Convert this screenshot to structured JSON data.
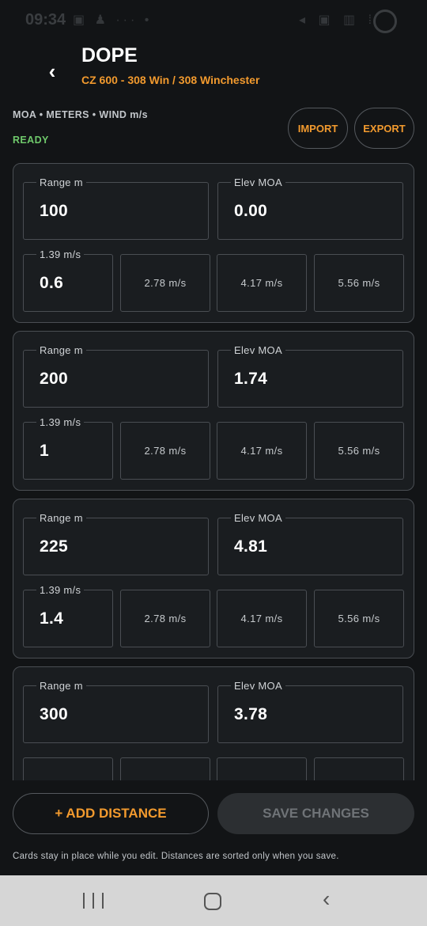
{
  "status_bar": {
    "time": "09:34",
    "left_icons": "▣ ♟ ··· •",
    "right_icons": "◂ ▣ ▥ ⁞"
  },
  "header": {
    "back_glyph": "‹",
    "title": "DOPE",
    "subtitle": "CZ 600 - 308 Win / 308 Winchester",
    "units": "MOA • METERS • WIND m/s",
    "status": "READY",
    "import_label": "IMPORT",
    "export_label": "EXPORT"
  },
  "colors": {
    "accent": "#f29a2e",
    "ready": "#6fc96b",
    "background": "#121416",
    "card": "#1a1d20",
    "border": "#4a4e53"
  },
  "cards": [
    {
      "range_label": "Range m",
      "range": "100",
      "elev_label": "Elev MOA",
      "elev": "0.00",
      "wind": [
        {
          "label": "1.39 m/s",
          "value": "0.6"
        },
        {
          "placeholder": "2.78 m/s"
        },
        {
          "placeholder": "4.17 m/s"
        },
        {
          "placeholder": "5.56 m/s"
        }
      ]
    },
    {
      "range_label": "Range m",
      "range": "200",
      "elev_label": "Elev MOA",
      "elev": "1.74",
      "wind": [
        {
          "label": "1.39 m/s",
          "value": "1"
        },
        {
          "placeholder": "2.78 m/s"
        },
        {
          "placeholder": "4.17 m/s"
        },
        {
          "placeholder": "5.56 m/s"
        }
      ]
    },
    {
      "range_label": "Range m",
      "range": "225",
      "elev_label": "Elev MOA",
      "elev": "4.81",
      "wind": [
        {
          "label": "1.39 m/s",
          "value": "1.4"
        },
        {
          "placeholder": "2.78 m/s"
        },
        {
          "placeholder": "4.17 m/s"
        },
        {
          "placeholder": "5.56 m/s"
        }
      ]
    },
    {
      "range_label": "Range m",
      "range": "300",
      "elev_label": "Elev MOA",
      "elev": "3.78",
      "wind": [
        {
          "label": "",
          "value": ""
        },
        {
          "placeholder": ""
        },
        {
          "placeholder": ""
        },
        {
          "placeholder": ""
        }
      ]
    }
  ],
  "actions": {
    "add_label": "+ ADD DISTANCE",
    "save_label": "SAVE CHANGES"
  },
  "hint": "Cards stay in place while you edit. Distances are sorted only when you save.",
  "nav": {
    "back_glyph": "‹"
  }
}
